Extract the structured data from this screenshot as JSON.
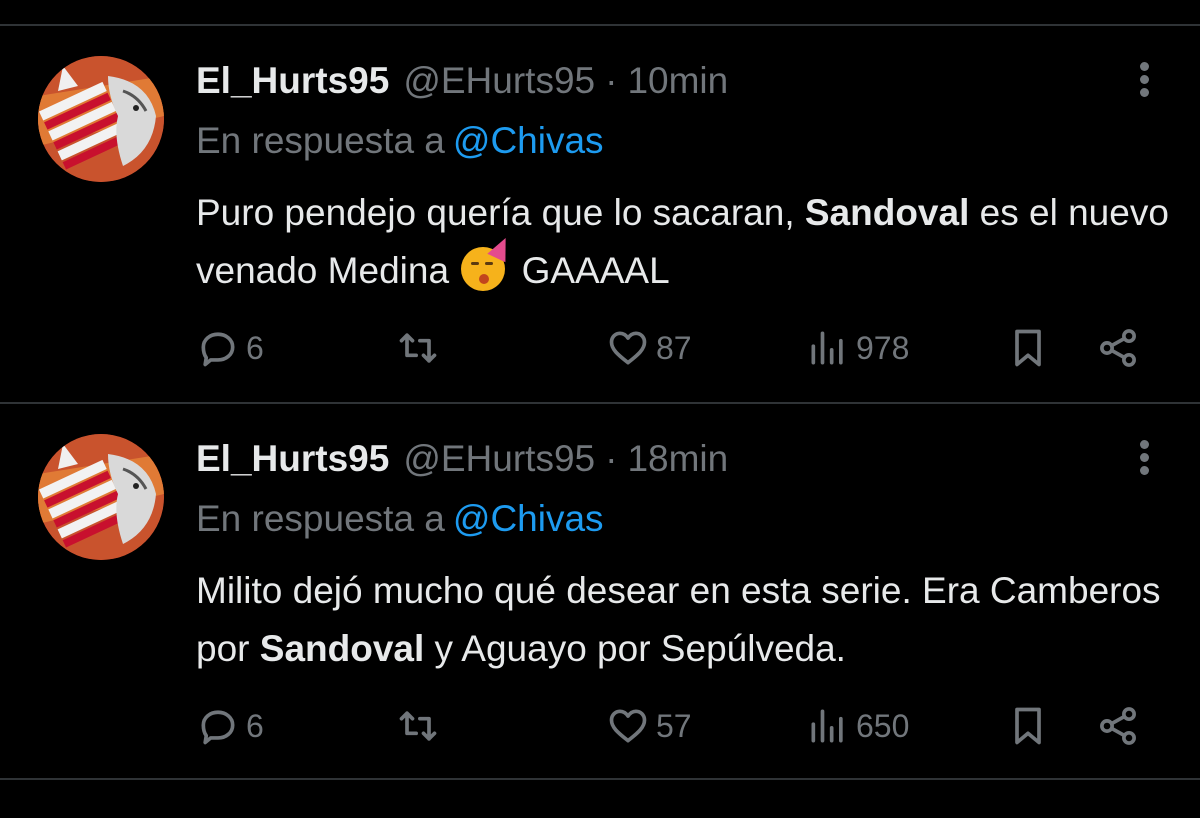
{
  "tweets": [
    {
      "name": "El_Hurts95",
      "handle": "@EHurts95",
      "separator": "·",
      "time": "10min",
      "reply_prefix": "En respuesta a",
      "reply_mention": "@Chivas",
      "body_part1": "Puro pendejo quería que lo sacaran, ",
      "body_bold": "Sandoval",
      "body_part2": " es el nuevo venado Medina ",
      "body_part3": " GAAAAL",
      "emoji": "partying-face",
      "replies": "6",
      "likes": "87",
      "views": "978"
    },
    {
      "name": "El_Hurts95",
      "handle": "@EHurts95",
      "separator": "·",
      "time": "18min",
      "reply_prefix": "En respuesta a",
      "reply_mention": "@Chivas",
      "body_part1": "Milito dejó mucho qué desear en esta serie. Era Camberos por ",
      "body_bold": "Sandoval",
      "body_part2": " y Aguayo por Sepúlveda.",
      "replies": "6",
      "likes": "57",
      "views": "650"
    }
  ],
  "colors": {
    "background": "#000000",
    "text": "#e7e9ea",
    "muted": "#71767b",
    "link": "#1d9bf0",
    "divider": "#2f3336"
  }
}
